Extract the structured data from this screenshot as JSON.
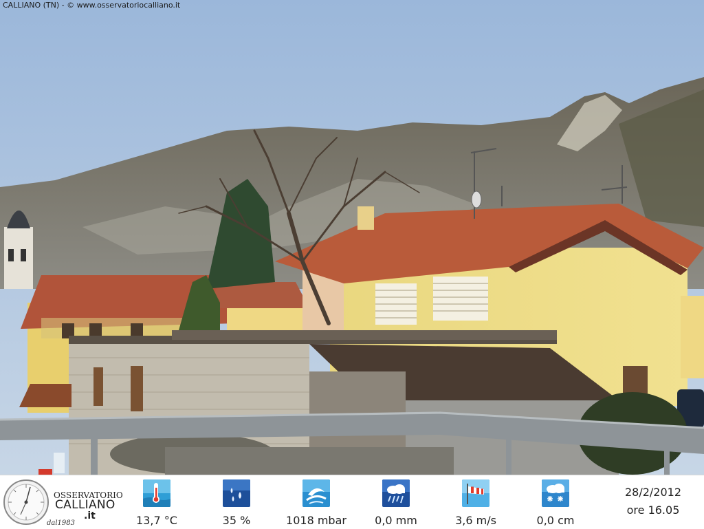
{
  "caption": "CALLIANO (TN) - © www.osservatoriocalliano.it",
  "logo": {
    "line1": "OSSERVATORIO",
    "line2": "CALLIANO",
    "line3": ".it",
    "line4": "dal1983"
  },
  "metrics": [
    {
      "icon": "thermometer-icon",
      "value": "13,7 °C"
    },
    {
      "icon": "humidity-drops-icon",
      "value": "35 %"
    },
    {
      "icon": "pressure-icon",
      "value": "1018 mbar"
    },
    {
      "icon": "rain-cloud-icon",
      "value": "0,0 mm"
    },
    {
      "icon": "windsock-icon",
      "value": "3,6 m/s"
    },
    {
      "icon": "snow-cloud-icon",
      "value": "0,0 cm"
    }
  ],
  "datetime": {
    "date": "28/2/2012",
    "time": "ore 16.05"
  }
}
